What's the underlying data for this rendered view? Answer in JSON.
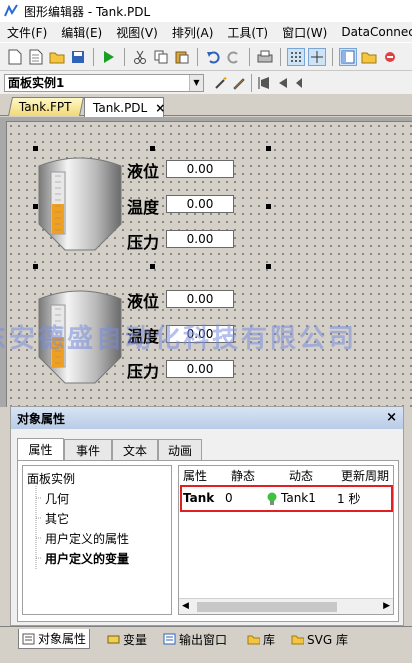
{
  "window": {
    "title": "图形编辑器 - Tank.PDL"
  },
  "menu": {
    "items": [
      "文件(F)",
      "编辑(E)",
      "视图(V)",
      "排列(A)",
      "工具(T)",
      "窗口(W)",
      "DataConnecto"
    ]
  },
  "objrow": {
    "selected": "面板实例1"
  },
  "doc_tabs": [
    {
      "label": "Tank.FPT"
    },
    {
      "label": "Tank.PDL"
    }
  ],
  "canvas": {
    "panel1": {
      "labels": [
        "液位",
        "温度",
        "压力"
      ],
      "values": [
        "0.00",
        "0.00",
        "0.00"
      ]
    },
    "panel2": {
      "labels": [
        "液位",
        "温度",
        "压力"
      ],
      "values": [
        "0.00",
        "0.00",
        "0.00"
      ]
    },
    "watermark": "东安德盛自动化科技有限公司"
  },
  "props": {
    "title": "对象属性",
    "close": "×",
    "tabs": [
      "属性",
      "事件",
      "文本",
      "动画"
    ],
    "tree": [
      "面板实例",
      "几何",
      "其它",
      "用户定义的属性",
      "用户定义的变量"
    ],
    "grid": {
      "headers": [
        "属性",
        "静态",
        "动态",
        "更新周期"
      ],
      "row": {
        "name": "Tank",
        "static": "0",
        "dynamic": "Tank1",
        "cycle": "1 秒"
      }
    }
  },
  "bottom_tabs": [
    "对象属性",
    "变量",
    "输出窗口",
    "库",
    "SVG 库"
  ],
  "colors": {
    "highlight": "#e02020",
    "tank_fill": "#f0a020",
    "bulb": "#40c040"
  }
}
